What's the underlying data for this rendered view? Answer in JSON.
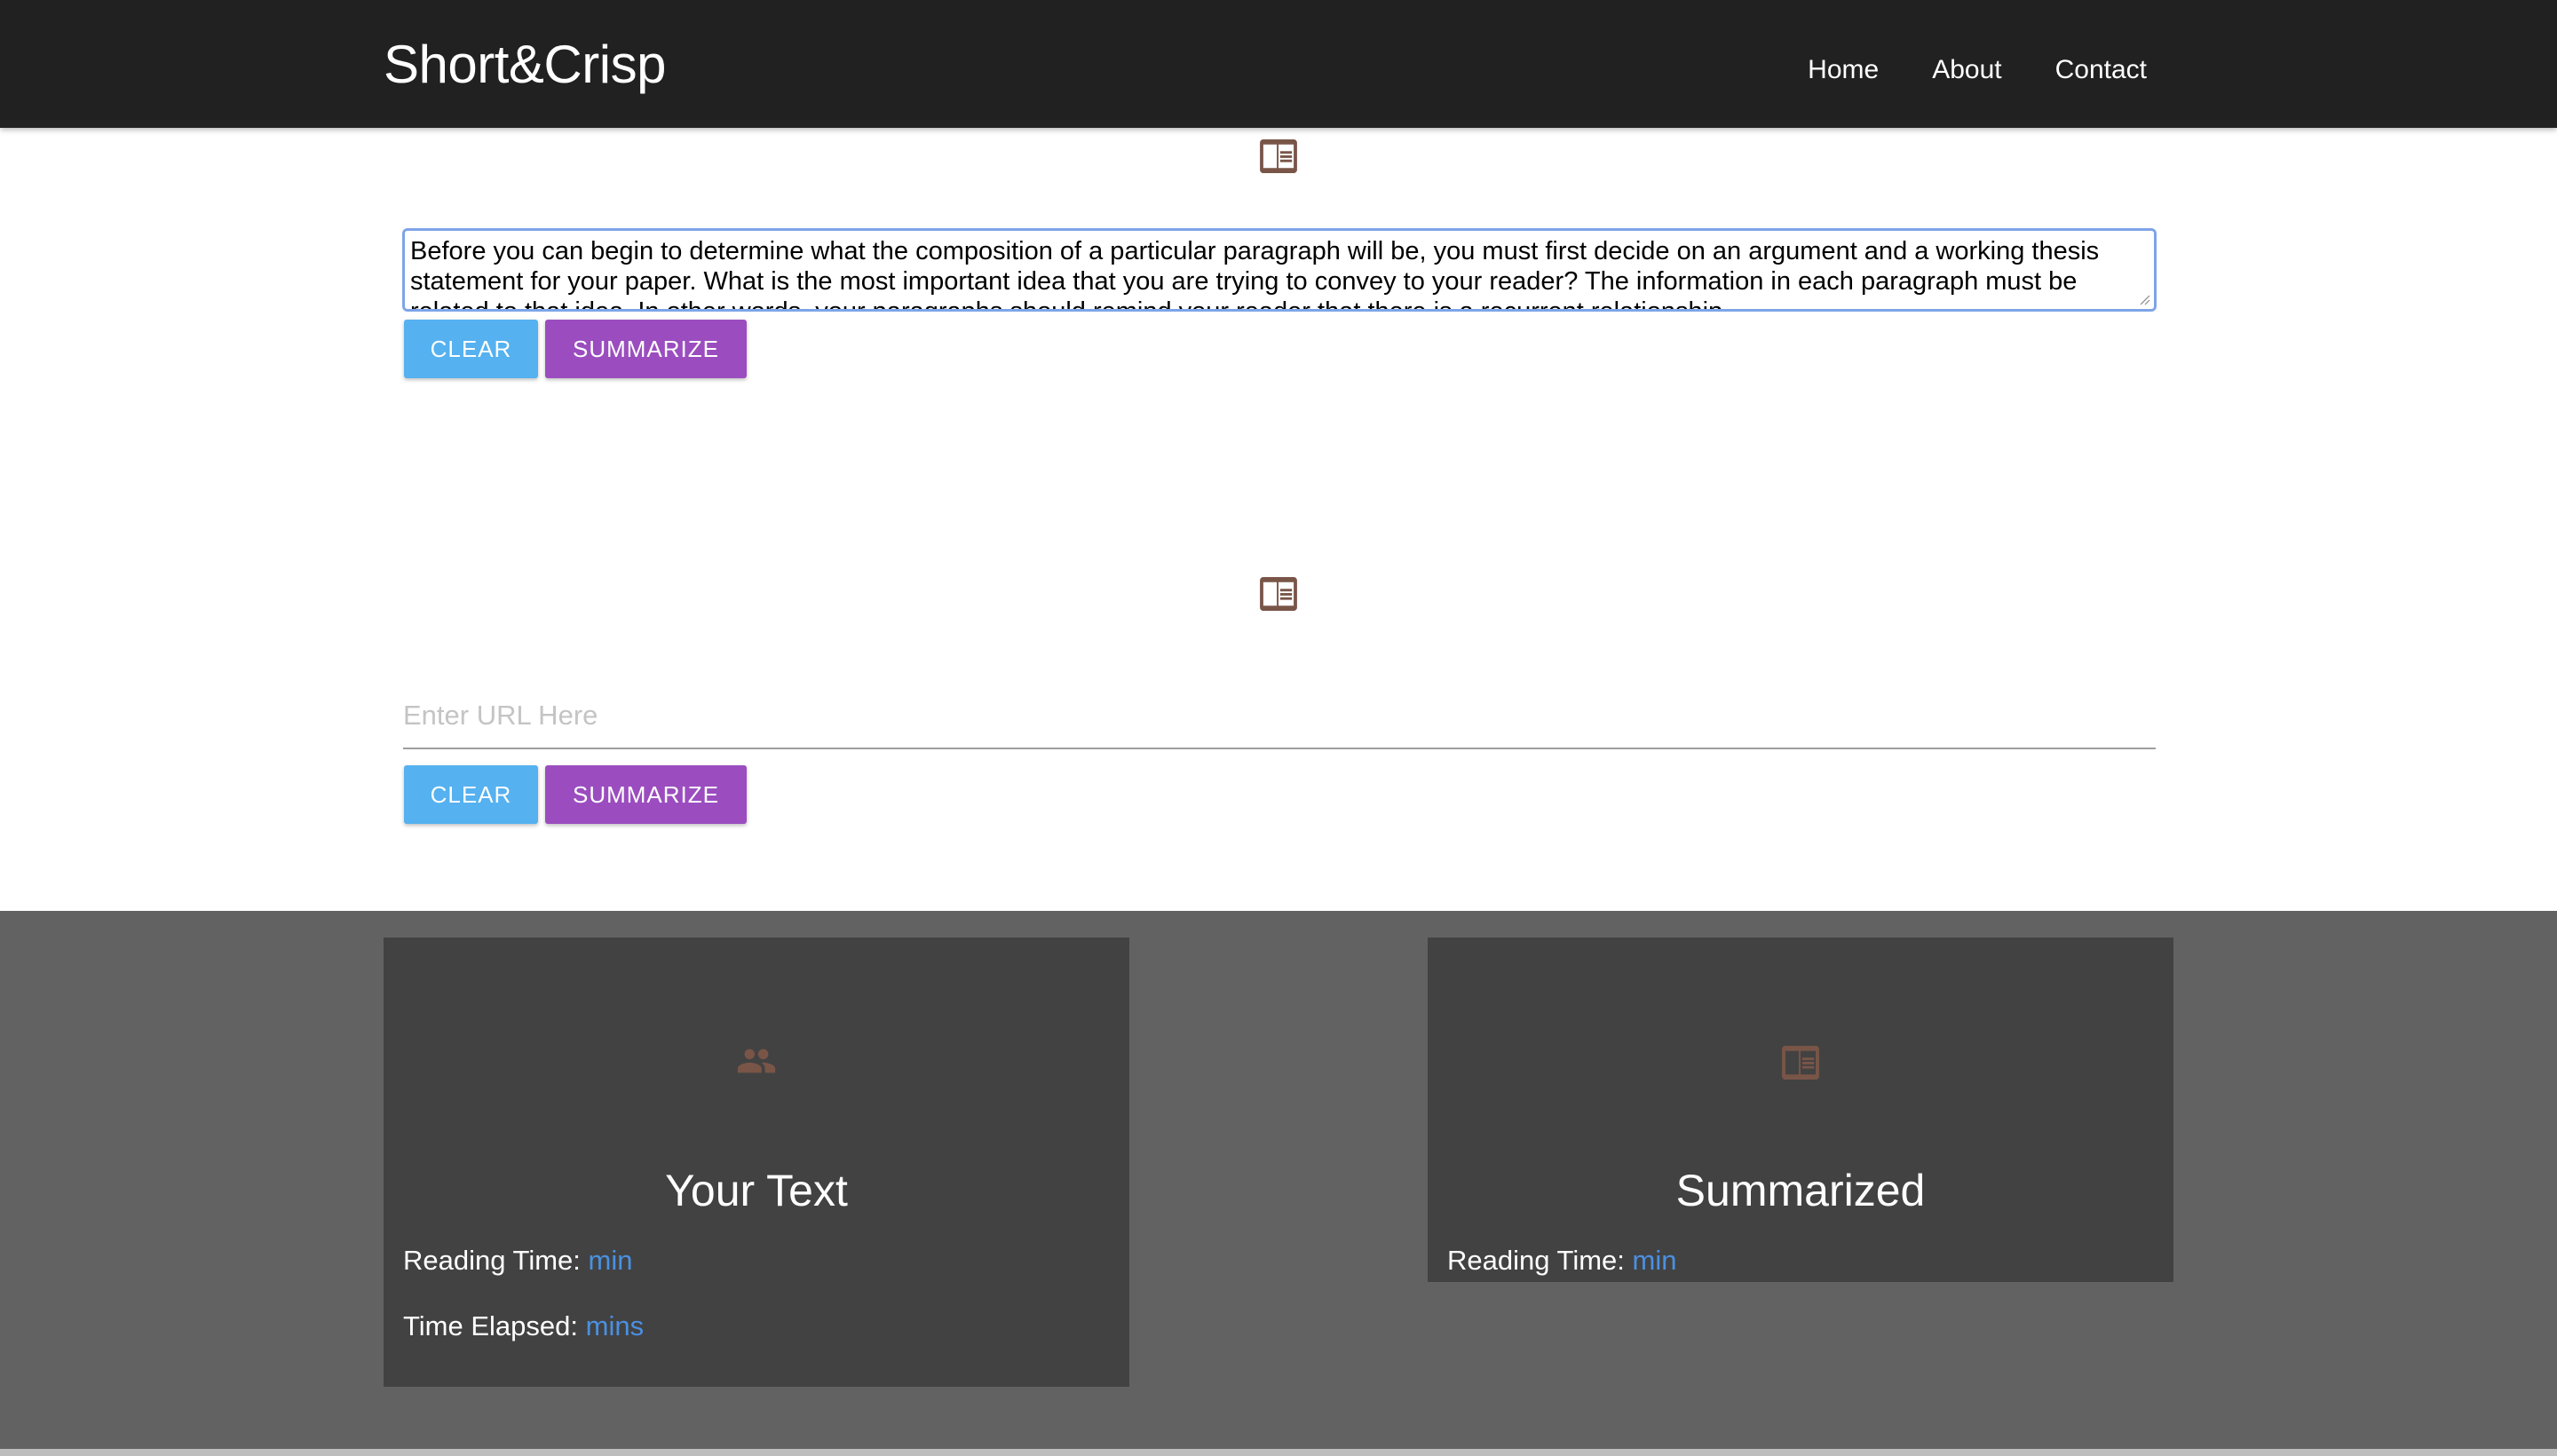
{
  "navbar": {
    "brand": "Short&Crisp",
    "links": [
      "Home",
      "About",
      "Contact"
    ]
  },
  "text_section": {
    "icon": "chrome-reader-mode-icon",
    "textarea_value": "Before you can begin to determine what the composition of a particular paragraph will be, you must first decide on an argument and a working thesis statement for your paper. What is the most important idea that you are trying to convey to your reader? The information in each paragraph must be related to that idea. In other words, your paragraphs should remind your reader that there is a recurrent relationship",
    "clear_label": "Clear",
    "summarize_label": "Summarize"
  },
  "url_section": {
    "icon": "chrome-reader-mode-icon",
    "placeholder": "Enter URL Here",
    "clear_label": "Clear",
    "summarize_label": "Summarize"
  },
  "cards": {
    "your_text": {
      "icon": "people-icon",
      "title": "Your Text",
      "reading_time_label": "Reading Time:",
      "reading_time_unit": "min",
      "time_elapsed_label": "Time Elapsed:",
      "time_elapsed_unit": "mins"
    },
    "summarized": {
      "icon": "chrome-reader-mode-icon",
      "title": "Summarized",
      "reading_time_label": "Reading Time:",
      "reading_time_unit": "min"
    }
  },
  "colors": {
    "navbar": "#212121",
    "clear_button": "#55b1ef",
    "summarize_button": "#9b4dbf",
    "icon_brown": "#795548",
    "card_bg": "#424242",
    "section_bg": "#626262",
    "unit_blue": "#4a90e2"
  }
}
